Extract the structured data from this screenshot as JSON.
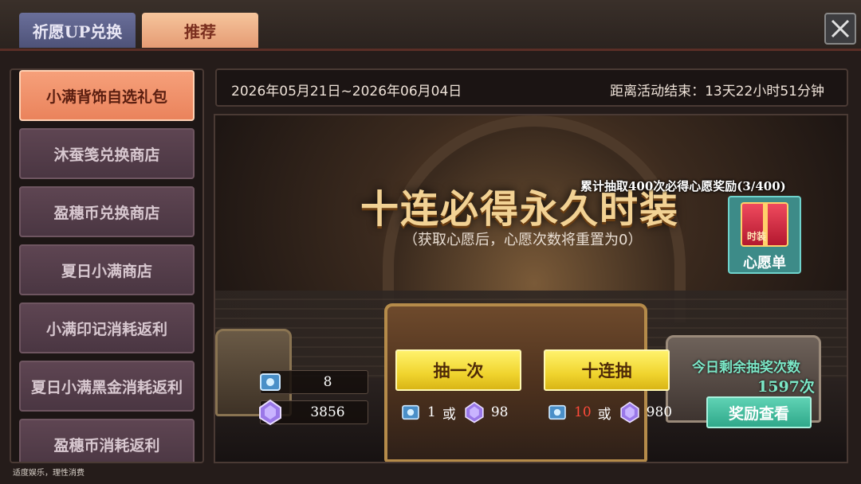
{
  "tabs": {
    "wish_up": "祈愿UP兑换",
    "recommend": "推荐"
  },
  "sidebar": {
    "items": [
      {
        "label": "小满背饰自选礼包",
        "active": true
      },
      {
        "label": "沐蚕笺兑换商店"
      },
      {
        "label": "盈穗币兑换商店"
      },
      {
        "label": "夏日小满商店"
      },
      {
        "label": "小满印记消耗返利"
      },
      {
        "label": "夏日小满黑金消耗返利"
      },
      {
        "label": "盈穗币消耗返利"
      }
    ]
  },
  "footer_note": "适度娱乐，理性消费",
  "event": {
    "date_range": "2026年05月21日~2026年06月04日",
    "countdown": "距离活动结束：13天22小时51分钟"
  },
  "banner": {
    "title": "十连必得永久时装",
    "subtitle": "（获取心愿后，心愿次数将重置为0）",
    "wish_progress": "累计抽取400次必得心愿奖励(3/400)",
    "wish_card_tag": "时装",
    "wish_card_label": "心愿单"
  },
  "currency": {
    "ticket_count": "8",
    "crystal_count": "3856"
  },
  "draw": {
    "single_label": "抽一次",
    "ten_label": "十连抽",
    "single_ticket_cost": "1",
    "single_or": "或",
    "single_crystal_cost": "98",
    "ten_ticket_cost": "10",
    "ten_or": "或",
    "ten_crystal_cost": "980"
  },
  "remaining": {
    "label": "今日剩余抽奖次数",
    "count": "1597次"
  },
  "reward_button": "奖励查看",
  "colors": {
    "active_tab": "#ea835c",
    "draw_button": "#f0d42e",
    "reward_button": "#2fa88a",
    "accent_teal": "#7be6c6"
  }
}
